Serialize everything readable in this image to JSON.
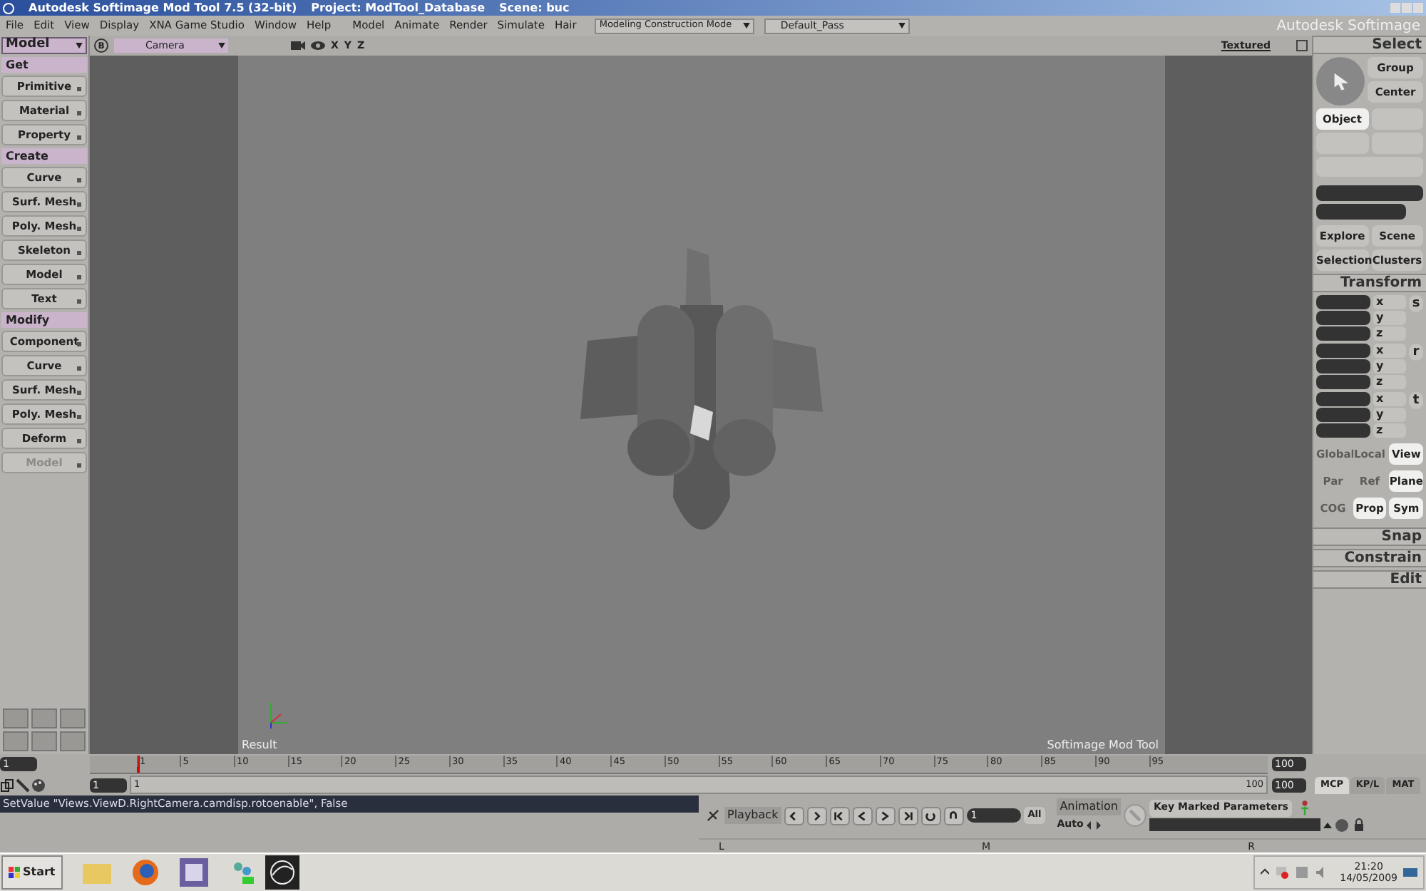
{
  "title_bar": {
    "app": "Autodesk Softimage Mod Tool 7.5 (32-bit)",
    "project": "Project: ModTool_Database",
    "scene": "Scene: buc"
  },
  "menu": [
    "File",
    "Edit",
    "View",
    "Display",
    "XNA Game Studio",
    "Window",
    "Help",
    "Model",
    "Animate",
    "Render",
    "Simulate",
    "Hair"
  ],
  "mode_dropdown": "Modeling Construction Mode",
  "pass_dropdown": "Default_Pass",
  "brand": "Autodesk Softimage",
  "left_panel": {
    "module": "Model",
    "sections": [
      {
        "title": "Get",
        "buttons": [
          {
            "label": "Primitive",
            "disabled": false
          },
          {
            "label": "Material",
            "disabled": false
          },
          {
            "label": "Property",
            "disabled": false
          }
        ]
      },
      {
        "title": "Create",
        "buttons": [
          {
            "label": "Curve",
            "disabled": false
          },
          {
            "label": "Surf. Mesh",
            "disabled": false
          },
          {
            "label": "Poly. Mesh",
            "disabled": false
          },
          {
            "label": "Skeleton",
            "disabled": false
          },
          {
            "label": "Model",
            "disabled": false
          },
          {
            "label": "Text",
            "disabled": false
          }
        ]
      },
      {
        "title": "Modify",
        "buttons": [
          {
            "label": "Component",
            "disabled": false
          },
          {
            "label": "Curve",
            "disabled": false
          },
          {
            "label": "Surf. Mesh",
            "disabled": false
          },
          {
            "label": "Poly. Mesh",
            "disabled": false
          },
          {
            "label": "Deform",
            "disabled": false
          },
          {
            "label": "Model",
            "disabled": true
          }
        ]
      }
    ]
  },
  "viewport": {
    "view_button": "B",
    "camera": "Camera",
    "axes": [
      "X",
      "Y",
      "Z"
    ],
    "display_mode": "Textured",
    "label_left": "Result",
    "label_right": "Softimage Mod Tool"
  },
  "right_panel": {
    "select_title": "Select",
    "group": "Group",
    "center": "Center",
    "object": {
      "label": "Object",
      "selected": true
    },
    "explore": "Explore",
    "scene": "Scene",
    "selection": "Selection",
    "clusters": "Clusters",
    "transform_title": "Transform",
    "transform_groups": [
      {
        "key": "s",
        "axes": [
          "x",
          "y",
          "z"
        ]
      },
      {
        "key": "r",
        "axes": [
          "x",
          "y",
          "z"
        ]
      },
      {
        "key": "t",
        "axes": [
          "x",
          "y",
          "z"
        ]
      }
    ],
    "toggle_rows": [
      [
        {
          "label": "Global",
          "on": false
        },
        {
          "label": "Local",
          "on": false
        },
        {
          "label": "View",
          "on": true
        }
      ],
      [
        {
          "label": "Par",
          "on": false
        },
        {
          "label": "Ref",
          "on": false
        },
        {
          "label": "Plane",
          "on": true
        }
      ],
      [
        {
          "label": "COG",
          "on": false
        },
        {
          "label": "Prop",
          "on": true
        },
        {
          "label": "Sym",
          "on": true
        }
      ]
    ],
    "sections": [
      "Snap",
      "Constrain",
      "Edit"
    ]
  },
  "timeline": {
    "ticks": [
      "1",
      "5",
      "10",
      "15",
      "20",
      "25",
      "30",
      "35",
      "40",
      "45",
      "50",
      "55",
      "60",
      "65",
      "70",
      "75",
      "80",
      "85",
      "90",
      "95"
    ],
    "start": "1",
    "end": "100",
    "range_start": "1",
    "range_label_start": "1",
    "range_label_end": "100",
    "range_end": "100",
    "range": {
      "level": 1
    }
  },
  "tabs": [
    {
      "label": "MCP",
      "selected": true
    },
    {
      "label": "KP/L",
      "selected": false
    },
    {
      "label": "MAT",
      "selected": false
    }
  ],
  "command_line": "SetValue \"Views.ViewD.RightCamera.camdisp.rotoenable\", False",
  "playback": {
    "label": "Playback",
    "frame": "1",
    "all": "All",
    "animation": "Animation",
    "auto": "Auto",
    "key_marked": "Key Marked Parameters"
  },
  "mixer": [
    "L",
    "M",
    "R"
  ],
  "taskbar": {
    "start": "Start",
    "time": "21:20",
    "date": "14/05/2009"
  }
}
